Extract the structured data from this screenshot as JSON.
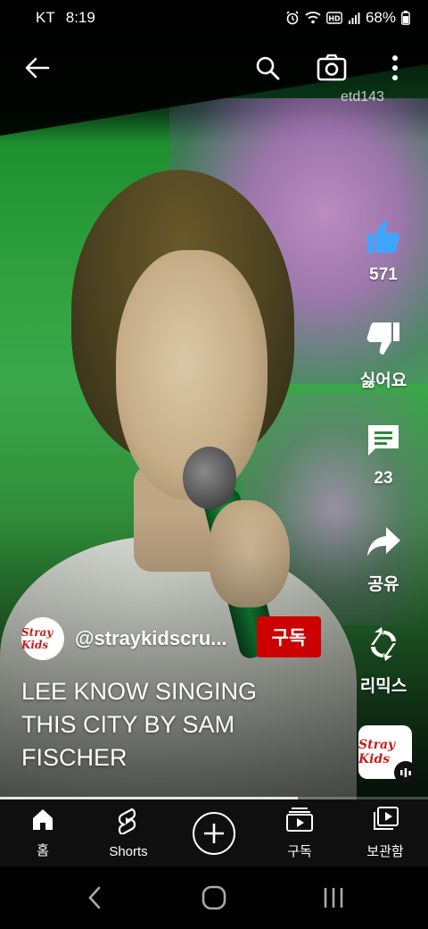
{
  "status_bar": {
    "carrier": "KT",
    "time": "8:19",
    "battery": "68%",
    "icons": [
      "alarm-icon",
      "wifi-icon",
      "hd-voice-icon",
      "signal-icon",
      "battery-icon"
    ]
  },
  "top_bar": {
    "channel_hint": "etd143",
    "icons": [
      "back-arrow-icon",
      "search-icon",
      "camera-icon",
      "more-vert-icon"
    ]
  },
  "actions": {
    "like_label": "571",
    "dislike_label": "싫어요",
    "comment_label": "23",
    "share_label": "공유",
    "remix_label": "리믹스"
  },
  "channel": {
    "avatar_text": "Stray Kids",
    "handle": "@straykidscru...",
    "subscribe_label": "구독"
  },
  "video": {
    "title": "LEE KNOW SINGING THIS CITY BY SAM FISCHER",
    "progress": 0.695
  },
  "sound": {
    "thumb_text": "Stray Kids"
  },
  "bottom_nav": {
    "home": "홈",
    "shorts": "Shorts",
    "subscriptions": "구독",
    "library": "보관함"
  },
  "colors": {
    "subscribe": "#cc0000",
    "nav_bg": "#0f0f0f"
  }
}
